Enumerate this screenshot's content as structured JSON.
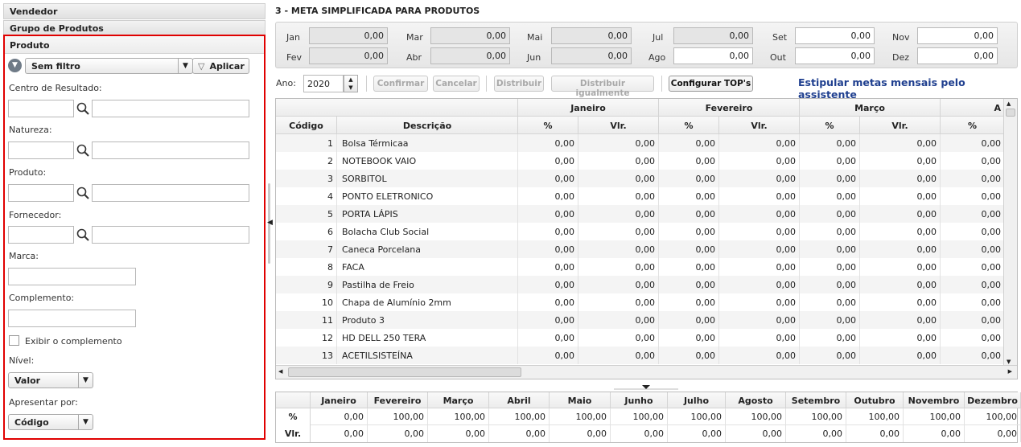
{
  "left": {
    "accordion": [
      "Vendedor",
      "Grupo de Produtos",
      "Produto"
    ],
    "filter_select": "Sem filtro",
    "apply_label": "Aplicar",
    "fields": {
      "centro": "Centro de Resultado:",
      "natureza": "Natureza:",
      "produto": "Produto:",
      "fornecedor": "Fornecedor:",
      "marca": "Marca:",
      "complemento": "Complemento:",
      "exibir_complemento": "Exibir o complemento",
      "nivel": "Nível:",
      "nivel_value": "Valor",
      "apresentar": "Apresentar por:",
      "apresentar_value": "Código"
    }
  },
  "title": "3 - META SIMPLIFICADA PARA PRODUTOS",
  "months": [
    {
      "label": "Jan",
      "value": "0,00"
    },
    {
      "label": "Fev",
      "value": "0,00"
    },
    {
      "label": "Mar",
      "value": "0,00"
    },
    {
      "label": "Abr",
      "value": "0,00"
    },
    {
      "label": "Mai",
      "value": "0,00"
    },
    {
      "label": "Jun",
      "value": "0,00"
    },
    {
      "label": "Jul",
      "value": "0,00"
    },
    {
      "label": "Ago",
      "value": "0,00"
    },
    {
      "label": "Set",
      "value": "0,00"
    },
    {
      "label": "Out",
      "value": "0,00"
    },
    {
      "label": "Nov",
      "value": "0,00"
    },
    {
      "label": "Dez",
      "value": "0,00"
    }
  ],
  "toolbar": {
    "ano_label": "Ano:",
    "ano_value": "2020",
    "confirmar": "Confirmar",
    "cancelar": "Cancelar",
    "distribuir": "Distribuir",
    "distribuir_igual": "Distribuir igualmente",
    "configurar": "Configurar TOP's",
    "assist_link": "Estipular metas mensais pelo assistente"
  },
  "grid": {
    "month_groups": [
      "Janeiro",
      "Fevereiro",
      "Março",
      "A"
    ],
    "col_codigo": "Código",
    "col_descricao": "Descrição",
    "col_pct": "%",
    "col_vlr": "Vlr.",
    "rows": [
      {
        "codigo": "1",
        "descricao": "Bolsa Térmicaa"
      },
      {
        "codigo": "2",
        "descricao": "NOTEBOOK VAIO"
      },
      {
        "codigo": "3",
        "descricao": "SORBITOL"
      },
      {
        "codigo": "4",
        "descricao": "PONTO ELETRONICO"
      },
      {
        "codigo": "5",
        "descricao": "PORTA LÁPIS"
      },
      {
        "codigo": "6",
        "descricao": "Bolacha Club Social"
      },
      {
        "codigo": "7",
        "descricao": "Caneca Porcelana"
      },
      {
        "codigo": "8",
        "descricao": "FACA"
      },
      {
        "codigo": "9",
        "descricao": "Pastilha de Freio"
      },
      {
        "codigo": "10",
        "descricao": "Chapa de Alumínio 2mm"
      },
      {
        "codigo": "11",
        "descricao": "Produto 3"
      },
      {
        "codigo": "12",
        "descricao": "HD DELL 250 TERA"
      },
      {
        "codigo": "13",
        "descricao": "ACETILSISTEÍNA"
      }
    ],
    "cell_value": "0,00"
  },
  "summary": {
    "months": [
      "Janeiro",
      "Fevereiro",
      "Março",
      "Abril",
      "Maio",
      "Junho",
      "Julho",
      "Agosto",
      "Setembro",
      "Outubro",
      "Novembro",
      "Dezembro"
    ],
    "pct_label": "%",
    "vlr_label": "Vlr.",
    "pct_values": [
      "0,00",
      "100,00",
      "100,00",
      "100,00",
      "100,00",
      "100,00",
      "100,00",
      "100,00",
      "100,00",
      "100,00",
      "100,00",
      "100,00"
    ],
    "vlr_values": [
      "0,00",
      "0,00",
      "0,00",
      "0,00",
      "0,00",
      "0,00",
      "0,00",
      "0,00",
      "0,00",
      "0,00",
      "0,00",
      "0,00"
    ]
  }
}
